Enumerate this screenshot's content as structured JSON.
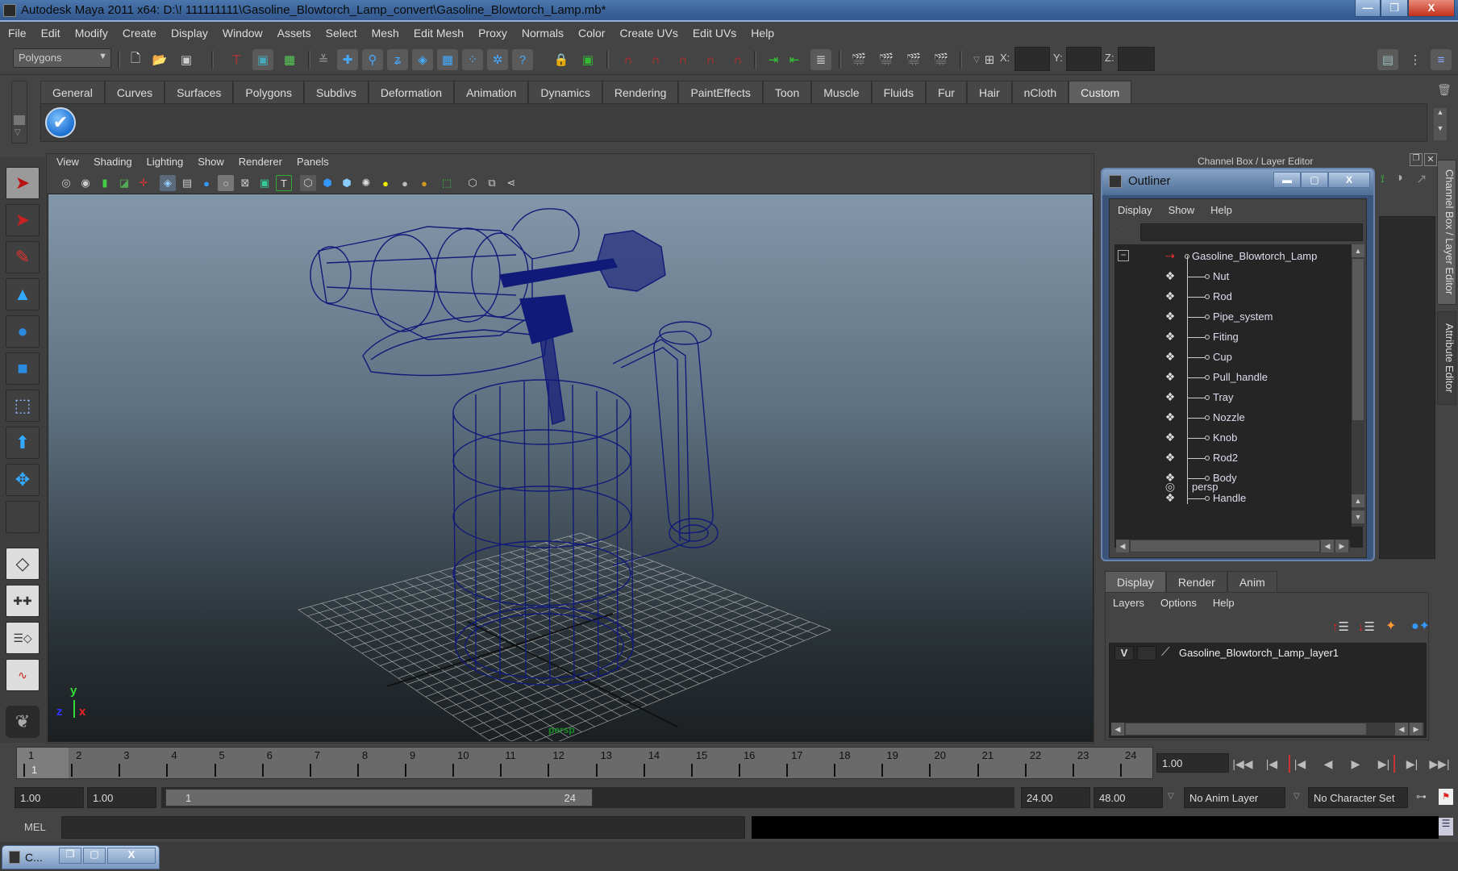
{
  "window": {
    "title": "Autodesk Maya 2011 x64: D:\\! 111111111\\Gasoline_Blowtorch_Lamp_convert\\Gasoline_Blowtorch_Lamp.mb*",
    "minimize": "—",
    "restore": "❐",
    "close": "X"
  },
  "menubar": [
    "File",
    "Edit",
    "Modify",
    "Create",
    "Display",
    "Window",
    "Assets",
    "Select",
    "Mesh",
    "Edit Mesh",
    "Proxy",
    "Normals",
    "Color",
    "Create UVs",
    "Edit UVs",
    "Help"
  ],
  "toolbar": {
    "mode_selector": "Polygons",
    "x_label": "X:",
    "y_label": "Y:",
    "z_label": "Z:",
    "x_value": "",
    "y_value": "",
    "z_value": ""
  },
  "shelf": {
    "tabs": [
      "General",
      "Curves",
      "Surfaces",
      "Polygons",
      "Subdivs",
      "Deformation",
      "Animation",
      "Dynamics",
      "Rendering",
      "PaintEffects",
      "Toon",
      "Muscle",
      "Fluids",
      "Fur",
      "Hair",
      "nCloth",
      "Custom"
    ],
    "active_tab": "Custom",
    "check_icon": "✔"
  },
  "viewport": {
    "menu": [
      "View",
      "Shading",
      "Lighting",
      "Show",
      "Renderer",
      "Panels"
    ],
    "camera_name": "persp",
    "axis": {
      "y": "y",
      "z": "z",
      "x": "x"
    },
    "wire_color": "#101a78"
  },
  "right_panel": {
    "title": "Channel Box / Layer Editor",
    "side_tabs": [
      "Channel Box / Layer Editor",
      "Attribute Editor"
    ]
  },
  "outliner": {
    "title": "Outliner",
    "menu": [
      "Display",
      "Show",
      "Help"
    ],
    "filter_value": "",
    "root": "Gasoline_Blowtorch_Lamp",
    "children": [
      "Nut",
      "Rod",
      "Pipe_system",
      "Fiting",
      "Cup",
      "Pull_handle",
      "Tray",
      "Nozzle",
      "Knob",
      "Rod2",
      "Body",
      "Handle"
    ],
    "camera": "persp",
    "collapse_symbol": "−"
  },
  "layer_editor": {
    "tabs": [
      "Display",
      "Render",
      "Anim"
    ],
    "active_tab": "Display",
    "menu": [
      "Layers",
      "Options",
      "Help"
    ],
    "layers": [
      {
        "visible": "V",
        "name": "Gasoline_Blowtorch_Lamp_layer1"
      }
    ]
  },
  "timeline": {
    "ticks": [
      "1",
      "2",
      "3",
      "4",
      "5",
      "6",
      "7",
      "8",
      "9",
      "10",
      "11",
      "12",
      "13",
      "14",
      "15",
      "16",
      "17",
      "18",
      "19",
      "20",
      "21",
      "22",
      "23",
      "24"
    ],
    "current_frame_marker": "1",
    "current_time": "1.00"
  },
  "range": {
    "start_time": "1.00",
    "playback_start": "1.00",
    "slider_start": "1",
    "slider_end": "24",
    "playback_end": "24.00",
    "end_time": "48.00",
    "anim_layer": "No Anim Layer",
    "character_set": "No Character Set"
  },
  "command_line": {
    "label": "MEL",
    "input": ""
  },
  "minimized_window": {
    "label": "C...",
    "restore": "❐",
    "maximize": "▢",
    "close": "X"
  }
}
